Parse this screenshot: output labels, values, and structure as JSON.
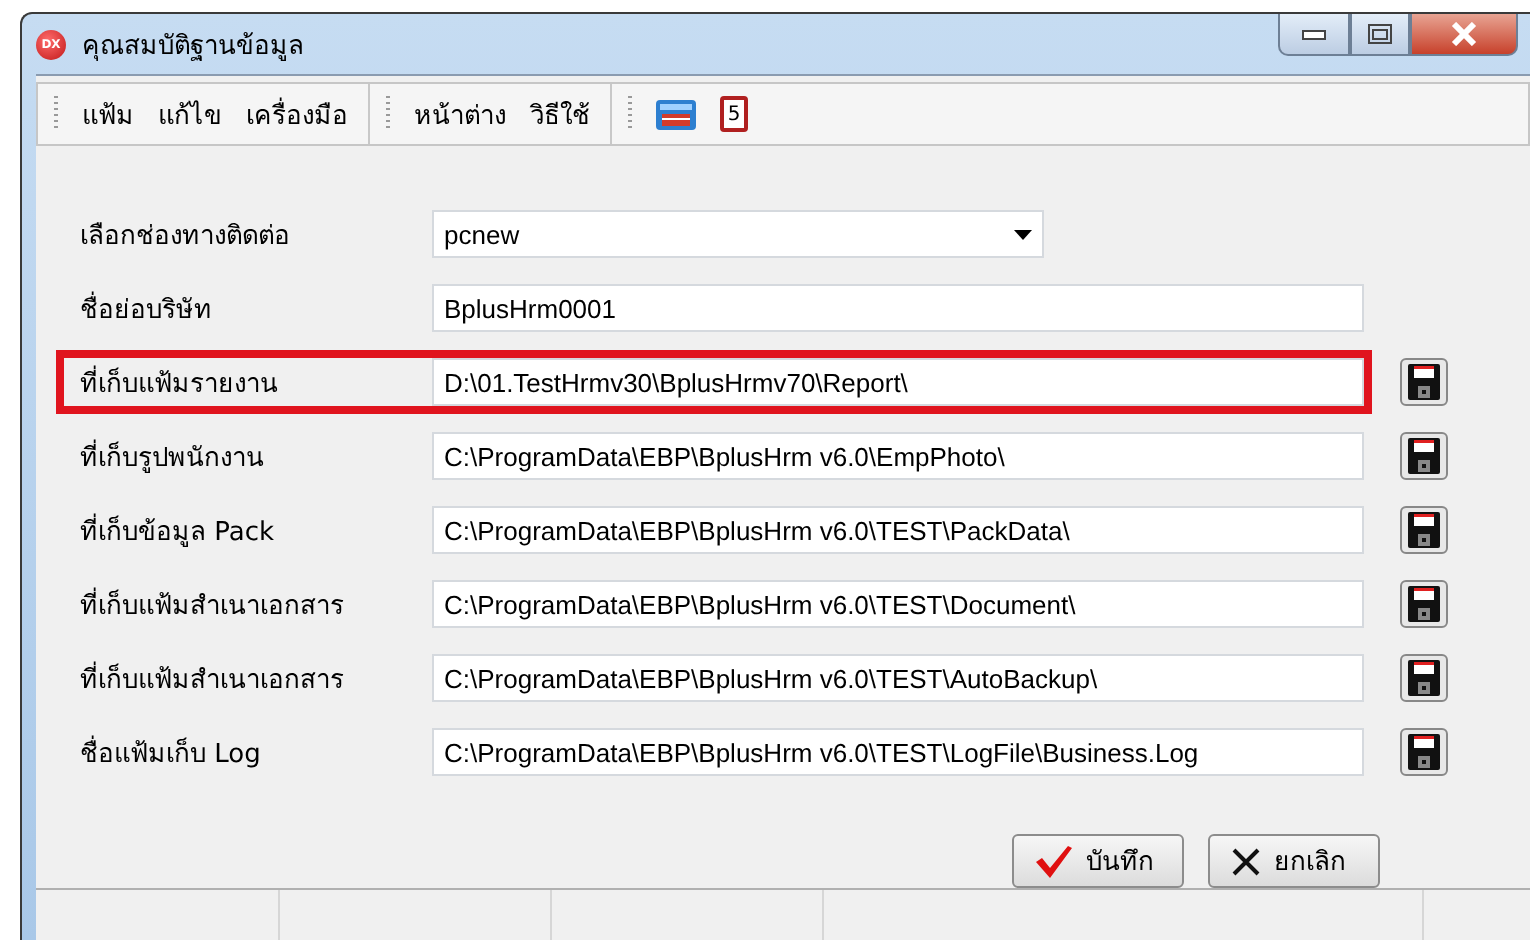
{
  "window": {
    "title": "คุณสมบัติฐานข้อมูล",
    "icon_text": "DX"
  },
  "toolbar": {
    "groups": [
      {
        "kind": "menu",
        "items": [
          "แฟ้ม",
          "แก้ไข",
          "เครื่องมือ"
        ]
      },
      {
        "kind": "menu",
        "items": [
          "หน้าต่าง",
          "วิธีใช้"
        ]
      },
      {
        "kind": "icons",
        "items": [
          "5"
        ]
      }
    ]
  },
  "fields": [
    {
      "kind": "combo",
      "label": "เลือกช่องทางติดต่อ",
      "value": "pcnew",
      "highlighted": false
    },
    {
      "kind": "text",
      "label": "ชื่อย่อบริษัท",
      "value": "BplusHrm0001",
      "highlighted": false
    },
    {
      "kind": "path",
      "label": "ที่เก็บแฟ้มรายงาน",
      "value": "D:\\01.TestHrmv30\\BplusHrmv70\\Report\\",
      "highlighted": true
    },
    {
      "kind": "path",
      "label": "ที่เก็บรูปพนักงาน",
      "value": "C:\\ProgramData\\EBP\\BplusHrm v6.0\\EmpPhoto\\",
      "highlighted": false
    },
    {
      "kind": "path",
      "label": "ที่เก็บข้อมูล Pack",
      "value": "C:\\ProgramData\\EBP\\BplusHrm v6.0\\TEST\\PackData\\",
      "highlighted": false
    },
    {
      "kind": "path",
      "label": "ที่เก็บแฟ้มสำเนาเอกสาร",
      "value": "C:\\ProgramData\\EBP\\BplusHrm v6.0\\TEST\\Document\\",
      "highlighted": false
    },
    {
      "kind": "path",
      "label": "ที่เก็บแฟ้มสำเนาเอกสาร",
      "value": "C:\\ProgramData\\EBP\\BplusHrm v6.0\\TEST\\AutoBackup\\",
      "highlighted": false
    },
    {
      "kind": "path",
      "label": "ชื่อแฟ้มเก็บ Log",
      "value": "C:\\ProgramData\\EBP\\BplusHrm v6.0\\TEST\\LogFile\\Business.Log",
      "highlighted": false
    }
  ],
  "buttons": [
    {
      "kind": "ok",
      "label": "บันทึก"
    },
    {
      "kind": "cancel",
      "label": "ยกเลิก"
    }
  ]
}
